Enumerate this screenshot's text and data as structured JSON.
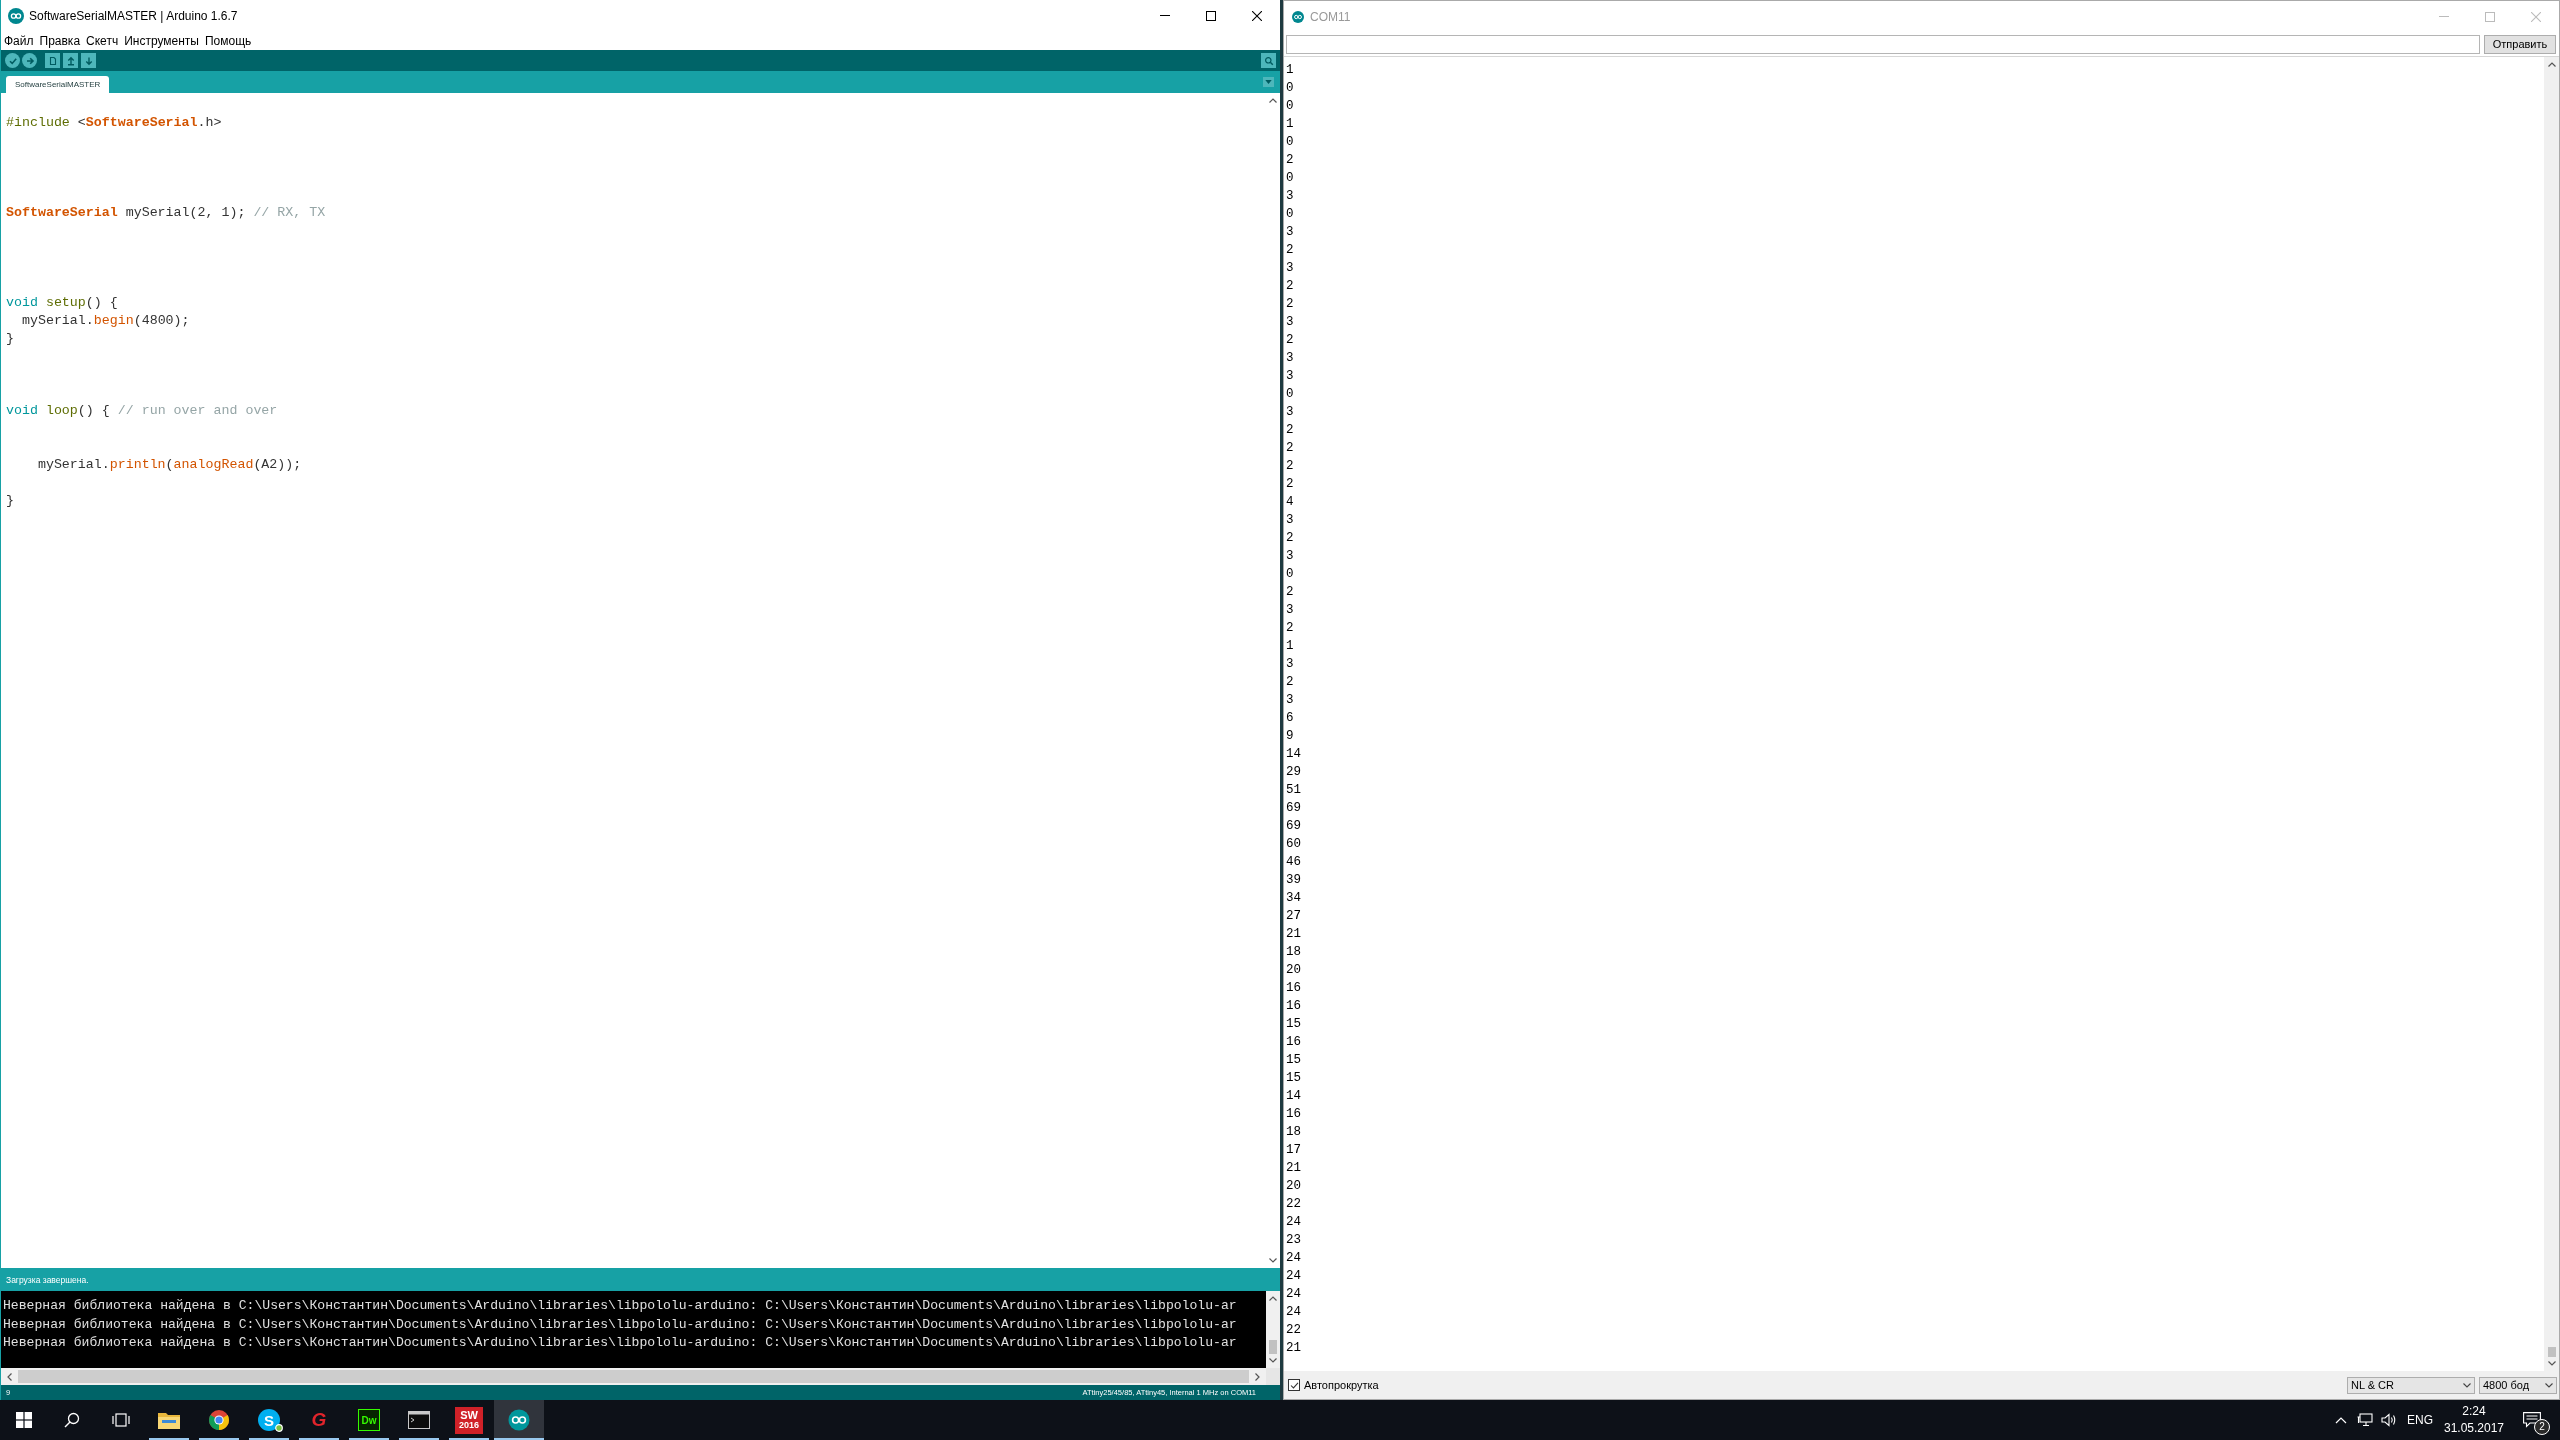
{
  "ide_window": {
    "title": "SoftwareSerialMASTER | Arduino 1.6.7",
    "focused": true,
    "menu": [
      "Файл",
      "Правка",
      "Скетч",
      "Инструменты",
      "Помощь"
    ],
    "tabs": [
      {
        "label": "SoftwareSerialMASTER",
        "selected": true
      }
    ],
    "code_lines": [
      {
        "kind": "code",
        "tokens": [
          {
            "text": "#include",
            "kind": "directive"
          },
          {
            "text": " <",
            "kind": "plain"
          },
          {
            "text": "SoftwareSerial",
            "kind": "class"
          },
          {
            "text": ".h>",
            "kind": "plain"
          }
        ]
      },
      {
        "kind": "blank"
      },
      {
        "kind": "blank"
      },
      {
        "kind": "blank"
      },
      {
        "kind": "blank"
      },
      {
        "kind": "code",
        "tokens": [
          {
            "text": "SoftwareSerial",
            "kind": "class"
          },
          {
            "text": " mySerial(2, 1); ",
            "kind": "plain"
          },
          {
            "text": "// RX, TX",
            "kind": "comment"
          }
        ]
      },
      {
        "kind": "blank"
      },
      {
        "kind": "blank"
      },
      {
        "kind": "blank"
      },
      {
        "kind": "blank"
      },
      {
        "kind": "code",
        "tokens": [
          {
            "text": "void ",
            "kind": "keyword"
          },
          {
            "text": "setup",
            "kind": "function"
          },
          {
            "text": "() {",
            "kind": "plain"
          }
        ]
      },
      {
        "kind": "code",
        "tokens": [
          {
            "text": "  mySerial.",
            "kind": "plain"
          },
          {
            "text": "begin",
            "kind": "method"
          },
          {
            "text": "(4800);",
            "kind": "plain"
          }
        ]
      },
      {
        "kind": "code",
        "tokens": [
          {
            "text": "}",
            "kind": "plain"
          }
        ]
      },
      {
        "kind": "blank"
      },
      {
        "kind": "blank"
      },
      {
        "kind": "blank"
      },
      {
        "kind": "code",
        "tokens": [
          {
            "text": "void ",
            "kind": "keyword"
          },
          {
            "text": "loop",
            "kind": "function"
          },
          {
            "text": "() { ",
            "kind": "plain"
          },
          {
            "text": "// run over and over",
            "kind": "comment"
          }
        ]
      },
      {
        "kind": "blank"
      },
      {
        "kind": "blank"
      },
      {
        "kind": "code",
        "tokens": [
          {
            "text": "    mySerial.",
            "kind": "plain"
          },
          {
            "text": "println",
            "kind": "method"
          },
          {
            "text": "(",
            "kind": "plain"
          },
          {
            "text": "analogRead",
            "kind": "method"
          },
          {
            "text": "(A2));",
            "kind": "plain"
          }
        ]
      },
      {
        "kind": "blank"
      },
      {
        "kind": "code",
        "tokens": [
          {
            "text": "}",
            "kind": "plain"
          }
        ]
      }
    ],
    "status_message": "Загрузка завершена.",
    "console_lines": [
      "Неверная библиотека найдена в C:\\Users\\Константин\\Documents\\Arduino\\libraries\\libpololu-arduino: C:\\Users\\Константин\\Documents\\Arduino\\libraries\\libpololu-ar",
      "Неверная библиотека найдена в C:\\Users\\Константин\\Documents\\Arduino\\libraries\\libpololu-arduino: C:\\Users\\Константин\\Documents\\Arduino\\libraries\\libpololu-ar",
      "Неверная библиотека найдена в C:\\Users\\Константин\\Documents\\Arduino\\libraries\\libpololu-arduino: C:\\Users\\Константин\\Documents\\Arduino\\libraries\\libpololu-ar"
    ],
    "line_number": "9",
    "board_info": "ATtiny25/45/85, ATtiny45, Internal 1 MHz on COM11"
  },
  "serial_monitor": {
    "title": "COM11",
    "focused": false,
    "send_button": "Отправить",
    "output_lines": [
      "1",
      "0",
      "0",
      "1",
      "0",
      "2",
      "0",
      "3",
      "0",
      "3",
      "2",
      "3",
      "2",
      "2",
      "3",
      "2",
      "3",
      "3",
      "0",
      "3",
      "2",
      "2",
      "2",
      "2",
      "4",
      "3",
      "2",
      "3",
      "0",
      "2",
      "3",
      "2",
      "1",
      "3",
      "2",
      "3",
      "6",
      "9",
      "14",
      "29",
      "51",
      "69",
      "69",
      "60",
      "46",
      "39",
      "34",
      "27",
      "21",
      "18",
      "20",
      "16",
      "16",
      "15",
      "16",
      "15",
      "15",
      "14",
      "16",
      "18",
      "17",
      "21",
      "20",
      "22",
      "24",
      "23",
      "24",
      "24",
      "24",
      "24",
      "22",
      "21"
    ],
    "autoscroll": {
      "label": "Автопрокрутка",
      "checked": true
    },
    "line_ending": "NL & CR",
    "baud_rate": "4800 бод"
  },
  "taskbar": {
    "apps": [
      {
        "kind": "explorer",
        "running": true,
        "selected": false
      },
      {
        "kind": "chrome",
        "running": true,
        "selected": false
      },
      {
        "kind": "skype",
        "label": "S",
        "running": true,
        "selected": false
      },
      {
        "kind": "graphics",
        "label": "G",
        "running": true,
        "selected": false
      },
      {
        "kind": "dreamweaver",
        "label": "Dw",
        "running": true,
        "selected": false
      },
      {
        "kind": "console",
        "running": true,
        "selected": false
      },
      {
        "kind": "solidworks",
        "label": "SW",
        "sublabel": "2016",
        "running": true,
        "selected": false
      },
      {
        "kind": "arduino",
        "running": true,
        "selected": true
      }
    ],
    "language": "ENG",
    "time": "2:24",
    "date": "31.05.2017",
    "notification_count": "2"
  }
}
